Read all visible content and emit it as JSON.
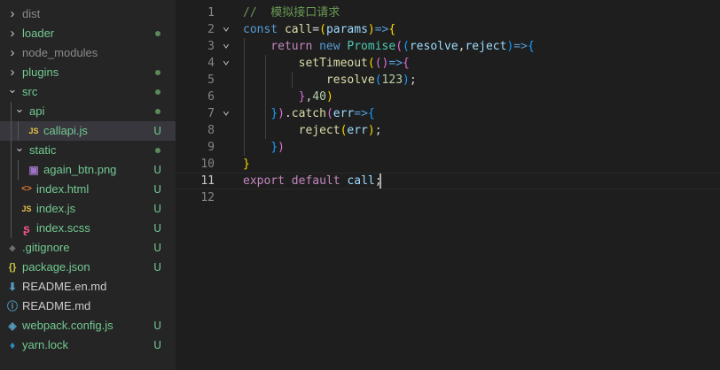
{
  "explorer": {
    "items": [
      {
        "label": "dist",
        "kind": "folder",
        "expanded": false,
        "color": "grey"
      },
      {
        "label": "loader",
        "kind": "folder",
        "expanded": false,
        "color": "green",
        "status": "dot"
      },
      {
        "label": "node_modules",
        "kind": "folder",
        "expanded": false,
        "color": "grey"
      },
      {
        "label": "plugins",
        "kind": "folder",
        "expanded": false,
        "color": "green",
        "status": "dot"
      },
      {
        "label": "src",
        "kind": "folder",
        "expanded": true,
        "color": "green",
        "status": "dot"
      },
      {
        "label": "api",
        "kind": "folder",
        "expanded": true,
        "color": "green",
        "status": "dot"
      },
      {
        "label": "callapi.js",
        "kind": "file",
        "icon": "JS",
        "color": "green",
        "status": "U",
        "selected": true
      },
      {
        "label": "static",
        "kind": "folder",
        "expanded": true,
        "color": "green",
        "status": "dot"
      },
      {
        "label": "again_btn.png",
        "kind": "file",
        "icon": "image",
        "color": "green",
        "status": "U"
      },
      {
        "label": "index.html",
        "kind": "file",
        "icon": "html",
        "color": "green",
        "status": "U"
      },
      {
        "label": "index.js",
        "kind": "file",
        "icon": "JS",
        "color": "green",
        "status": "U"
      },
      {
        "label": "index.scss",
        "kind": "file",
        "icon": "sass",
        "color": "green",
        "status": "U"
      },
      {
        "label": ".gitignore",
        "kind": "file",
        "icon": "git",
        "color": "green",
        "status": "U"
      },
      {
        "label": "package.json",
        "kind": "file",
        "icon": "json",
        "color": "green",
        "status": "U"
      },
      {
        "label": "README.en.md",
        "kind": "file",
        "icon": "download",
        "color": "white"
      },
      {
        "label": "README.md",
        "kind": "file",
        "icon": "info",
        "color": "white"
      },
      {
        "label": "webpack.config.js",
        "kind": "file",
        "icon": "webpack",
        "color": "green",
        "status": "U"
      },
      {
        "label": "yarn.lock",
        "kind": "file",
        "icon": "yarn",
        "color": "green",
        "status": "U"
      }
    ],
    "icons": {
      "js_color": "#e8c24a",
      "html_color": "#e37933",
      "sass_color": "#f55385",
      "json_color": "#cbcb41",
      "image_color": "#a074c4",
      "git_color": "#41535b",
      "info_color": "#519aba",
      "md_color": "#519aba",
      "webpack_color": "#519aba",
      "yarn_color": "#2c8ebb"
    },
    "status_colors": {
      "untracked": "#73c991",
      "folder_dot": "#5a8a5a"
    }
  },
  "editor": {
    "active_line": 12,
    "lines": [
      {
        "n": "1",
        "fold": "",
        "tokens": [
          {
            "t": "//  模拟接口请求",
            "c": "cm"
          }
        ]
      },
      {
        "n": "2",
        "fold": "v",
        "tokens": [
          {
            "t": "const ",
            "c": "kw"
          },
          {
            "t": "call",
            "c": "fn"
          },
          {
            "t": "=",
            "c": "pl"
          },
          {
            "t": "(",
            "c": "p1"
          },
          {
            "t": "params",
            "c": "var"
          },
          {
            "t": ")",
            "c": "p1"
          },
          {
            "t": "=>",
            "c": "kw"
          },
          {
            "t": "{",
            "c": "p1"
          }
        ]
      },
      {
        "n": "3",
        "fold": "v",
        "tokens": [
          {
            "t": "    return ",
            "c": "kw2"
          },
          {
            "t": "new ",
            "c": "kw"
          },
          {
            "t": "Promise",
            "c": "cls"
          },
          {
            "t": "(",
            "c": "p2"
          },
          {
            "t": "(",
            "c": "p3"
          },
          {
            "t": "resolve",
            "c": "var"
          },
          {
            "t": ",",
            "c": "pl"
          },
          {
            "t": "reject",
            "c": "var"
          },
          {
            "t": ")",
            "c": "p3"
          },
          {
            "t": "=>",
            "c": "kw"
          },
          {
            "t": "{",
            "c": "p3"
          }
        ]
      },
      {
        "n": "4",
        "fold": "v",
        "tokens": [
          {
            "t": "        setTimeout",
            "c": "fn"
          },
          {
            "t": "(",
            "c": "p1"
          },
          {
            "t": "()",
            "c": "p2"
          },
          {
            "t": "=>",
            "c": "kw"
          },
          {
            "t": "{",
            "c": "p2"
          }
        ]
      },
      {
        "n": "5",
        "fold": "",
        "tokens": [
          {
            "t": "            resolve",
            "c": "fn"
          },
          {
            "t": "(",
            "c": "p3"
          },
          {
            "t": "123",
            "c": "num"
          },
          {
            "t": ")",
            "c": "p3"
          },
          {
            "t": ";",
            "c": "pl"
          }
        ]
      },
      {
        "n": "6",
        "fold": "",
        "tokens": [
          {
            "t": "        ",
            "c": "pl"
          },
          {
            "t": "}",
            "c": "p2"
          },
          {
            "t": ",",
            "c": "pl"
          },
          {
            "t": "40",
            "c": "num"
          },
          {
            "t": ")",
            "c": "p1"
          }
        ]
      },
      {
        "n": "7",
        "fold": "v",
        "tokens": [
          {
            "t": "    ",
            "c": "pl"
          },
          {
            "t": "}",
            "c": "p3"
          },
          {
            "t": ")",
            "c": "p2"
          },
          {
            "t": ".",
            "c": "pl"
          },
          {
            "t": "catch",
            "c": "fn"
          },
          {
            "t": "(",
            "c": "p2"
          },
          {
            "t": "err",
            "c": "var"
          },
          {
            "t": "=>",
            "c": "kw"
          },
          {
            "t": "{",
            "c": "p3"
          }
        ]
      },
      {
        "n": "8",
        "fold": "",
        "tokens": [
          {
            "t": "        reject",
            "c": "fn"
          },
          {
            "t": "(",
            "c": "p1"
          },
          {
            "t": "err",
            "c": "var"
          },
          {
            "t": ")",
            "c": "p1"
          },
          {
            "t": ";",
            "c": "pl"
          }
        ]
      },
      {
        "n": "9",
        "fold": "",
        "tokens": [
          {
            "t": "    ",
            "c": "pl"
          },
          {
            "t": "}",
            "c": "p3"
          },
          {
            "t": ")",
            "c": "p2"
          }
        ]
      },
      {
        "n": "10",
        "fold": "",
        "tokens": [
          {
            "t": "}",
            "c": "p1"
          }
        ]
      },
      {
        "n": "11",
        "fold": "",
        "tokens": [
          {
            "t": "export ",
            "c": "kw2"
          },
          {
            "t": "default ",
            "c": "kw2"
          },
          {
            "t": "call",
            "c": "var"
          },
          {
            "t": ";",
            "c": "pl"
          }
        ]
      },
      {
        "n": "12",
        "fold": "",
        "tokens": []
      }
    ]
  }
}
